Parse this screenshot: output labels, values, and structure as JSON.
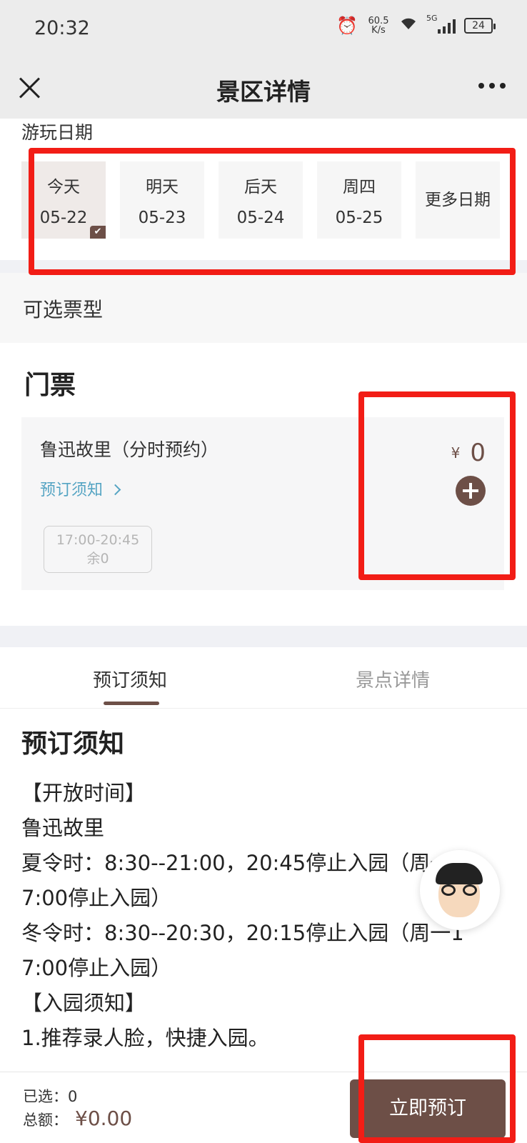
{
  "status_bar": {
    "time": "20:32",
    "net_speed_value": "60.5",
    "net_speed_unit": "K/s",
    "network_type": "5G",
    "battery": "24"
  },
  "nav": {
    "title": "景区详情"
  },
  "date_section": {
    "label": "游玩日期",
    "dates": [
      {
        "day": "今天",
        "date": "05-22",
        "selected": true
      },
      {
        "day": "明天",
        "date": "05-23",
        "selected": false
      },
      {
        "day": "后天",
        "date": "05-24",
        "selected": false
      },
      {
        "day": "周四",
        "date": "05-25",
        "selected": false
      }
    ],
    "more_label": "更多日期"
  },
  "ticket_types": {
    "label": "可选票型",
    "section_title": "门票",
    "ticket": {
      "name": "鲁迅故里（分时预约）",
      "notice_link": "预订须知",
      "currency": "¥",
      "price": "0",
      "slot_time": "17:00-20:45",
      "slot_remaining": "余0"
    }
  },
  "tabs": {
    "notice": "预订须知",
    "detail": "景点详情"
  },
  "notice": {
    "heading": "预订须知",
    "lines": [
      "【开放时间】",
      "鲁迅故里",
      "夏令时：8:30--21:00，20:45停止入园（周一1",
      "7:00停止入园）",
      "冬令时：8:30--20:30，20:15停止入园（周一1",
      "7:00停止入园）",
      "【入园须知】",
      "1.推荐录人脸，快捷入园。"
    ]
  },
  "bottom_bar": {
    "selected_label": "已选：",
    "selected_count": "0",
    "total_label": "总额：",
    "total_value": "¥0.00",
    "book_button": "立即预订"
  },
  "colors": {
    "accent": "#6d4f47",
    "link": "#55a4c3",
    "highlight": "#f21d16",
    "header_bg": "#ececec"
  }
}
